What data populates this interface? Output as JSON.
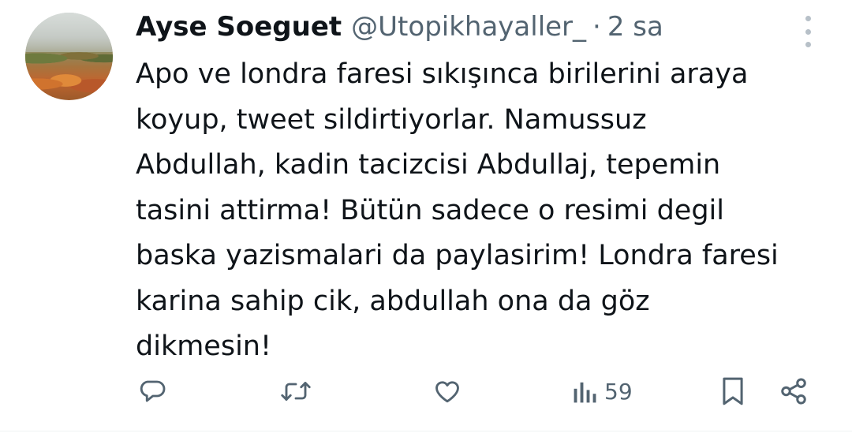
{
  "tweet": {
    "author_name": "Ayse Soeguet",
    "handle": "@Utopikhayaller_",
    "separator": "·",
    "time": "2 sa",
    "text_lines": [
      "Apo ve londra faresi sıkışınca birilerini araya",
      "koyup, tweet sildirtiyorlar. Namussuz",
      "Abdullah, kadin tacizcisi Abdullaj, tepemin",
      "tasini attirma! Bütün sadece o resimi degil",
      "baska yazismalari da paylasirim! Londra faresi",
      "karina sahip cik, abdullah ona da göz",
      "dikmesin!"
    ]
  },
  "actions": {
    "reply_icon": "reply-icon",
    "retweet_icon": "retweet-icon",
    "like_icon": "heart-icon",
    "views_icon": "views-icon",
    "views_count": "59",
    "bookmark_icon": "bookmark-icon",
    "share_icon": "share-icon"
  },
  "colors": {
    "text_primary": "#0f1419",
    "text_secondary": "#536471",
    "more_dots": "#b7c0c8"
  }
}
